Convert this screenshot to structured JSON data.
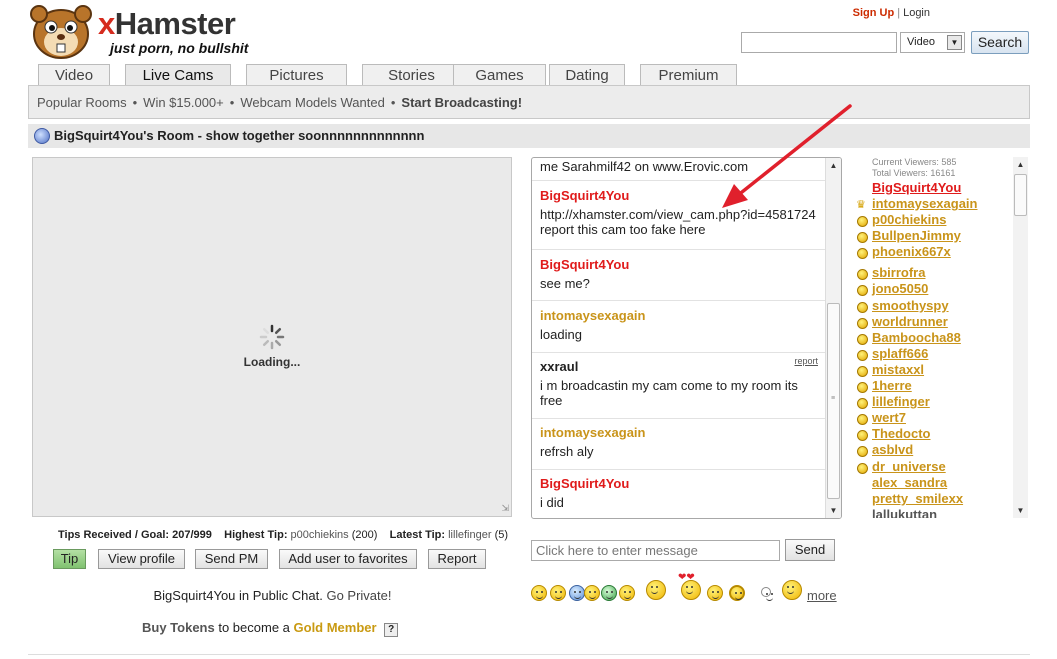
{
  "brand": {
    "name_x": "x",
    "name_rest": "Hamster",
    "tagline": "just porn, no bullshit"
  },
  "header": {
    "sign_up": "Sign Up",
    "separator": "|",
    "login": "Login"
  },
  "search": {
    "value": "",
    "category": "Video",
    "button": "Search"
  },
  "tabs": [
    "Video",
    "Live Cams",
    "Pictures",
    "Stories",
    "Games",
    "Dating",
    "Premium"
  ],
  "active_tab": "Live Cams",
  "subnav": [
    "Popular Rooms",
    "Win $15.000+",
    "Webcam Models Wanted",
    "Start Broadcasting!"
  ],
  "room": {
    "title": "BigSquirt4You's Room - show together soonnnnnnnnnnnnn"
  },
  "video": {
    "loading": "Loading..."
  },
  "stats": {
    "tips_label": "Tips Received / Goal:",
    "tips_value": "207/999",
    "highest_label": "Highest Tip:",
    "highest_user": "p00chiekins",
    "highest_amount": "(200)",
    "latest_label": "Latest Tip:",
    "latest_user": "lillefinger",
    "latest_amount": "(5)"
  },
  "actions": [
    "Tip",
    "View profile",
    "Send PM",
    "Add user to favorites",
    "Report"
  ],
  "public_chat": {
    "text": "BigSquirt4You in Public Chat.",
    "link": "Go Private!"
  },
  "tokens": {
    "buy": "Buy Tokens",
    "middle": "to become a",
    "gold": "Gold Member",
    "help": "?"
  },
  "chat": {
    "messages": [
      {
        "user": "",
        "color": "dark",
        "text": "me Sarahmilf42 on www.Erovic.com",
        "report": ""
      },
      {
        "user": "BigSquirt4You",
        "color": "red",
        "text": "http://xhamster.com/view_cam.php?id=4581724 report this cam too fake here",
        "report": ""
      },
      {
        "user": "BigSquirt4You",
        "color": "red",
        "text": "see me?",
        "report": ""
      },
      {
        "user": "intomaysexagain",
        "color": "gold",
        "text": "loading",
        "report": ""
      },
      {
        "user": "xxraul",
        "color": "dark",
        "text": "i m broadcastin my cam come to my room its free",
        "report": "report"
      },
      {
        "user": "intomaysexagain",
        "color": "gold",
        "text": "refrsh aly",
        "report": ""
      },
      {
        "user": "BigSquirt4You",
        "color": "red",
        "text": "i did",
        "report": ""
      }
    ],
    "input_placeholder": "Click here to enter message",
    "send": "Send",
    "more": "more"
  },
  "users": {
    "current_viewers": "Current Viewers: 585",
    "total_viewers": "Total Viewers: 16161",
    "list": [
      "BigSquirt4You",
      "intomaysexagain",
      "p00chiekins",
      "BullpenJimmy",
      "phoenix667x",
      "sbirrofra",
      "jono5050",
      "smoothyspy",
      "worldrunner",
      "Bamboocha88",
      "splaff666",
      "mistaxxl",
      "1herre",
      "lillefinger",
      "wert7",
      "Thedocto",
      "asblvd",
      "dr_universe",
      "alex_sandra",
      "pretty_smilexx",
      "lallukuttan"
    ]
  },
  "colors": {
    "red": "#e01b1b",
    "gold": "#c9941a",
    "link_red": "#cc2b00"
  }
}
